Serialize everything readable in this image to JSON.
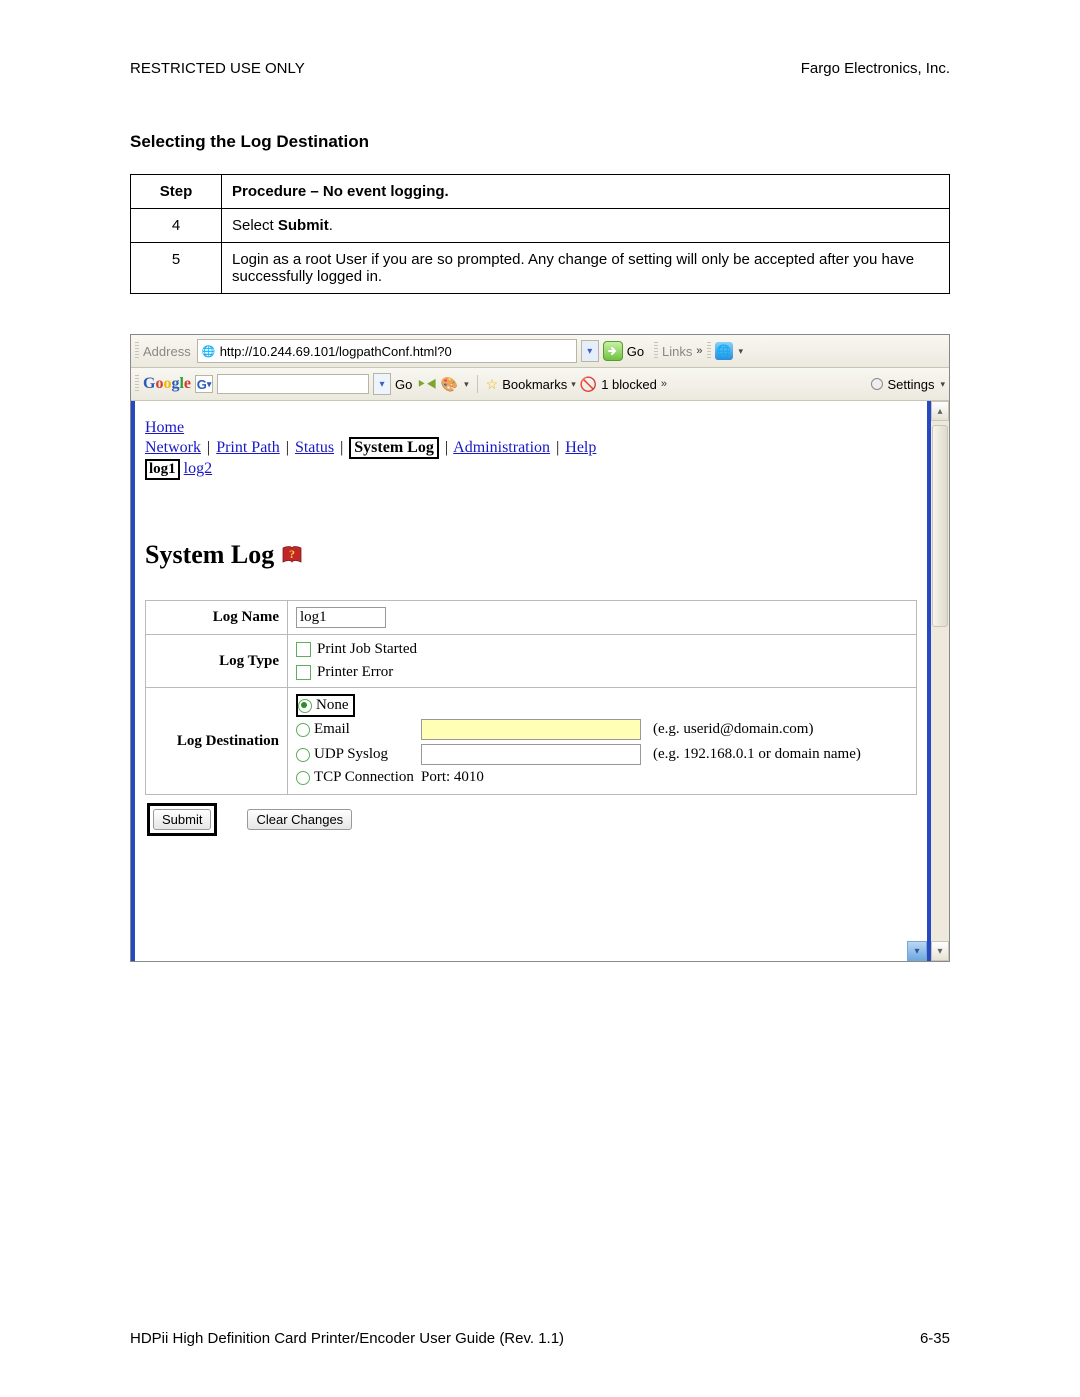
{
  "header": {
    "left": "RESTRICTED USE ONLY",
    "right": "Fargo Electronics, Inc."
  },
  "section_title": "Selecting the Log Destination",
  "proc_table": {
    "col_step": "Step",
    "col_proc": "Procedure – No event logging.",
    "rows": [
      {
        "step": "4",
        "text_prefix": "Select ",
        "text_bold": "Submit",
        "text_suffix": "."
      },
      {
        "step": "5",
        "text": "Login as a root User if you are so prompted. Any change of setting will only be accepted after you have successfully logged in."
      }
    ]
  },
  "browser": {
    "address_label": "Address",
    "url": "http://10.244.69.101/logpathConf.html?0",
    "go_label": "Go",
    "links_label": "Links",
    "google": {
      "go_label": "Go",
      "bookmarks": "Bookmarks",
      "blocked": "1 blocked",
      "settings": "Settings"
    }
  },
  "nav": {
    "home": "Home",
    "items": [
      "Network",
      "Print Path",
      "Status",
      "System Log",
      "Administration",
      "Help"
    ],
    "selected": "System Log",
    "sub": [
      "log1",
      "log2"
    ],
    "sub_selected": "log1"
  },
  "syslog": {
    "title": "System Log",
    "log_name_label": "Log Name",
    "log_name_value": "log1",
    "log_type_label": "Log Type",
    "log_type_opts": [
      "Print Job Started",
      "Printer Error"
    ],
    "dest_label": "Log Destination",
    "dest": {
      "none": "None",
      "email": "Email",
      "email_hint": "(e.g. userid@domain.com)",
      "udp": "UDP Syslog",
      "udp_hint": "(e.g. 192.168.0.1 or domain name)",
      "tcp": "TCP Connection",
      "tcp_port": "Port: 4010"
    },
    "submit": "Submit",
    "clear": "Clear Changes"
  },
  "footer": {
    "left": "HDPii High Definition Card Printer/Encoder User Guide (Rev. 1.1)",
    "right": "6-35"
  }
}
